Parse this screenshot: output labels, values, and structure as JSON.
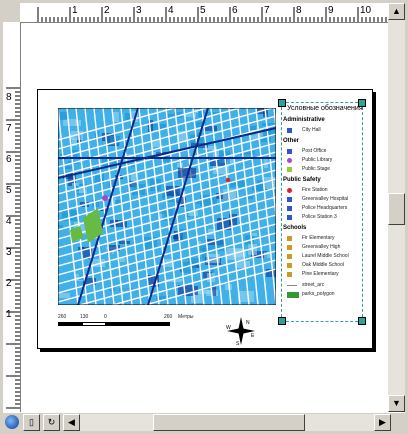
{
  "rulers": {
    "top_labels": [
      "1",
      "2",
      "3",
      "4",
      "5",
      "6",
      "7",
      "8",
      "9",
      "10"
    ],
    "left_labels": [
      "8",
      "7",
      "6",
      "5",
      "4",
      "3",
      "2",
      "1"
    ]
  },
  "legend": {
    "title": "Условные обозначения",
    "groups": [
      {
        "heading": "Administrative",
        "items": [
          {
            "label": "City Hall",
            "icon": "triangle-icon",
            "color": "#3355cc"
          }
        ]
      },
      {
        "heading": "Other",
        "items": [
          {
            "label": "Post Office",
            "icon": "square-icon",
            "color": "#3355cc"
          },
          {
            "label": "Public Library",
            "icon": "circle-icon",
            "color": "#aa44cc"
          },
          {
            "label": "Public Stage",
            "icon": "star-icon",
            "color": "#99cc33"
          }
        ]
      },
      {
        "heading": "Public Safety",
        "items": [
          {
            "label": "Fire Station",
            "icon": "circle-icon",
            "color": "#dd2222"
          },
          {
            "label": "Greenvalley Hospital",
            "icon": "square-icon",
            "color": "#3355cc"
          },
          {
            "label": "Police Headquarters",
            "icon": "star-icon",
            "color": "#3355cc"
          },
          {
            "label": "Police Station 3",
            "icon": "star-icon",
            "color": "#3355cc"
          }
        ]
      },
      {
        "heading": "Schools",
        "items": [
          {
            "label": "Fir Elementary",
            "icon": "school-icon",
            "color": "#cc9922"
          },
          {
            "label": "Greenvalley High",
            "icon": "school-icon",
            "color": "#cc9922"
          },
          {
            "label": "Laurel Middle School",
            "icon": "school-icon",
            "color": "#cc9922"
          },
          {
            "label": "Oak Middle School",
            "icon": "school-icon",
            "color": "#cc9922"
          },
          {
            "label": "Pine Elementary",
            "icon": "school-icon",
            "color": "#cc9922"
          }
        ]
      },
      {
        "heading": "",
        "items": [
          {
            "label": "street_arc",
            "icon": "line-icon",
            "color": "#888888"
          },
          {
            "label": "parks_polygon",
            "icon": "fill-icon",
            "color": "#339933"
          }
        ]
      }
    ]
  },
  "scale_bar": {
    "labels": [
      "260",
      "130",
      "0",
      "260"
    ],
    "unit": "Метры"
  },
  "compass": {
    "n": "N",
    "s": "S",
    "e": "E",
    "w": "W"
  },
  "colors": {
    "map_block": "#27a6e6",
    "map_dark": "#0d2a8a",
    "street": "#ffffff",
    "park": "#66bb44",
    "selection_handle": "#2aa398"
  }
}
